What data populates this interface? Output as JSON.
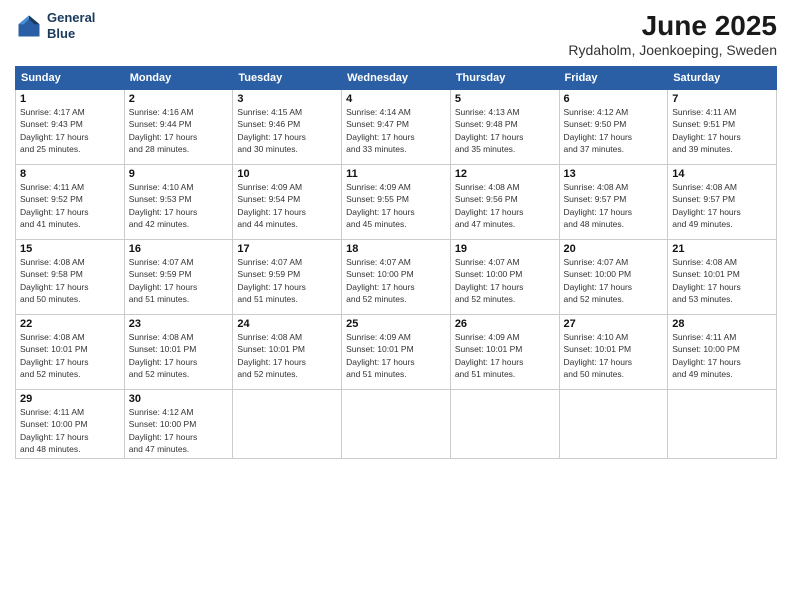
{
  "header": {
    "logo_line1": "General",
    "logo_line2": "Blue",
    "title": "June 2025",
    "subtitle": "Rydaholm, Joenkoeping, Sweden"
  },
  "weekdays": [
    "Sunday",
    "Monday",
    "Tuesday",
    "Wednesday",
    "Thursday",
    "Friday",
    "Saturday"
  ],
  "weeks": [
    [
      {
        "day": "1",
        "info": "Sunrise: 4:17 AM\nSunset: 9:43 PM\nDaylight: 17 hours\nand 25 minutes."
      },
      {
        "day": "2",
        "info": "Sunrise: 4:16 AM\nSunset: 9:44 PM\nDaylight: 17 hours\nand 28 minutes."
      },
      {
        "day": "3",
        "info": "Sunrise: 4:15 AM\nSunset: 9:46 PM\nDaylight: 17 hours\nand 30 minutes."
      },
      {
        "day": "4",
        "info": "Sunrise: 4:14 AM\nSunset: 9:47 PM\nDaylight: 17 hours\nand 33 minutes."
      },
      {
        "day": "5",
        "info": "Sunrise: 4:13 AM\nSunset: 9:48 PM\nDaylight: 17 hours\nand 35 minutes."
      },
      {
        "day": "6",
        "info": "Sunrise: 4:12 AM\nSunset: 9:50 PM\nDaylight: 17 hours\nand 37 minutes."
      },
      {
        "day": "7",
        "info": "Sunrise: 4:11 AM\nSunset: 9:51 PM\nDaylight: 17 hours\nand 39 minutes."
      }
    ],
    [
      {
        "day": "8",
        "info": "Sunrise: 4:11 AM\nSunset: 9:52 PM\nDaylight: 17 hours\nand 41 minutes."
      },
      {
        "day": "9",
        "info": "Sunrise: 4:10 AM\nSunset: 9:53 PM\nDaylight: 17 hours\nand 42 minutes."
      },
      {
        "day": "10",
        "info": "Sunrise: 4:09 AM\nSunset: 9:54 PM\nDaylight: 17 hours\nand 44 minutes."
      },
      {
        "day": "11",
        "info": "Sunrise: 4:09 AM\nSunset: 9:55 PM\nDaylight: 17 hours\nand 45 minutes."
      },
      {
        "day": "12",
        "info": "Sunrise: 4:08 AM\nSunset: 9:56 PM\nDaylight: 17 hours\nand 47 minutes."
      },
      {
        "day": "13",
        "info": "Sunrise: 4:08 AM\nSunset: 9:57 PM\nDaylight: 17 hours\nand 48 minutes."
      },
      {
        "day": "14",
        "info": "Sunrise: 4:08 AM\nSunset: 9:57 PM\nDaylight: 17 hours\nand 49 minutes."
      }
    ],
    [
      {
        "day": "15",
        "info": "Sunrise: 4:08 AM\nSunset: 9:58 PM\nDaylight: 17 hours\nand 50 minutes."
      },
      {
        "day": "16",
        "info": "Sunrise: 4:07 AM\nSunset: 9:59 PM\nDaylight: 17 hours\nand 51 minutes."
      },
      {
        "day": "17",
        "info": "Sunrise: 4:07 AM\nSunset: 9:59 PM\nDaylight: 17 hours\nand 51 minutes."
      },
      {
        "day": "18",
        "info": "Sunrise: 4:07 AM\nSunset: 10:00 PM\nDaylight: 17 hours\nand 52 minutes."
      },
      {
        "day": "19",
        "info": "Sunrise: 4:07 AM\nSunset: 10:00 PM\nDaylight: 17 hours\nand 52 minutes."
      },
      {
        "day": "20",
        "info": "Sunrise: 4:07 AM\nSunset: 10:00 PM\nDaylight: 17 hours\nand 52 minutes."
      },
      {
        "day": "21",
        "info": "Sunrise: 4:08 AM\nSunset: 10:01 PM\nDaylight: 17 hours\nand 53 minutes."
      }
    ],
    [
      {
        "day": "22",
        "info": "Sunrise: 4:08 AM\nSunset: 10:01 PM\nDaylight: 17 hours\nand 52 minutes."
      },
      {
        "day": "23",
        "info": "Sunrise: 4:08 AM\nSunset: 10:01 PM\nDaylight: 17 hours\nand 52 minutes."
      },
      {
        "day": "24",
        "info": "Sunrise: 4:08 AM\nSunset: 10:01 PM\nDaylight: 17 hours\nand 52 minutes."
      },
      {
        "day": "25",
        "info": "Sunrise: 4:09 AM\nSunset: 10:01 PM\nDaylight: 17 hours\nand 51 minutes."
      },
      {
        "day": "26",
        "info": "Sunrise: 4:09 AM\nSunset: 10:01 PM\nDaylight: 17 hours\nand 51 minutes."
      },
      {
        "day": "27",
        "info": "Sunrise: 4:10 AM\nSunset: 10:01 PM\nDaylight: 17 hours\nand 50 minutes."
      },
      {
        "day": "28",
        "info": "Sunrise: 4:11 AM\nSunset: 10:00 PM\nDaylight: 17 hours\nand 49 minutes."
      }
    ],
    [
      {
        "day": "29",
        "info": "Sunrise: 4:11 AM\nSunset: 10:00 PM\nDaylight: 17 hours\nand 48 minutes."
      },
      {
        "day": "30",
        "info": "Sunrise: 4:12 AM\nSunset: 10:00 PM\nDaylight: 17 hours\nand 47 minutes."
      },
      {
        "day": "",
        "info": ""
      },
      {
        "day": "",
        "info": ""
      },
      {
        "day": "",
        "info": ""
      },
      {
        "day": "",
        "info": ""
      },
      {
        "day": "",
        "info": ""
      }
    ]
  ]
}
